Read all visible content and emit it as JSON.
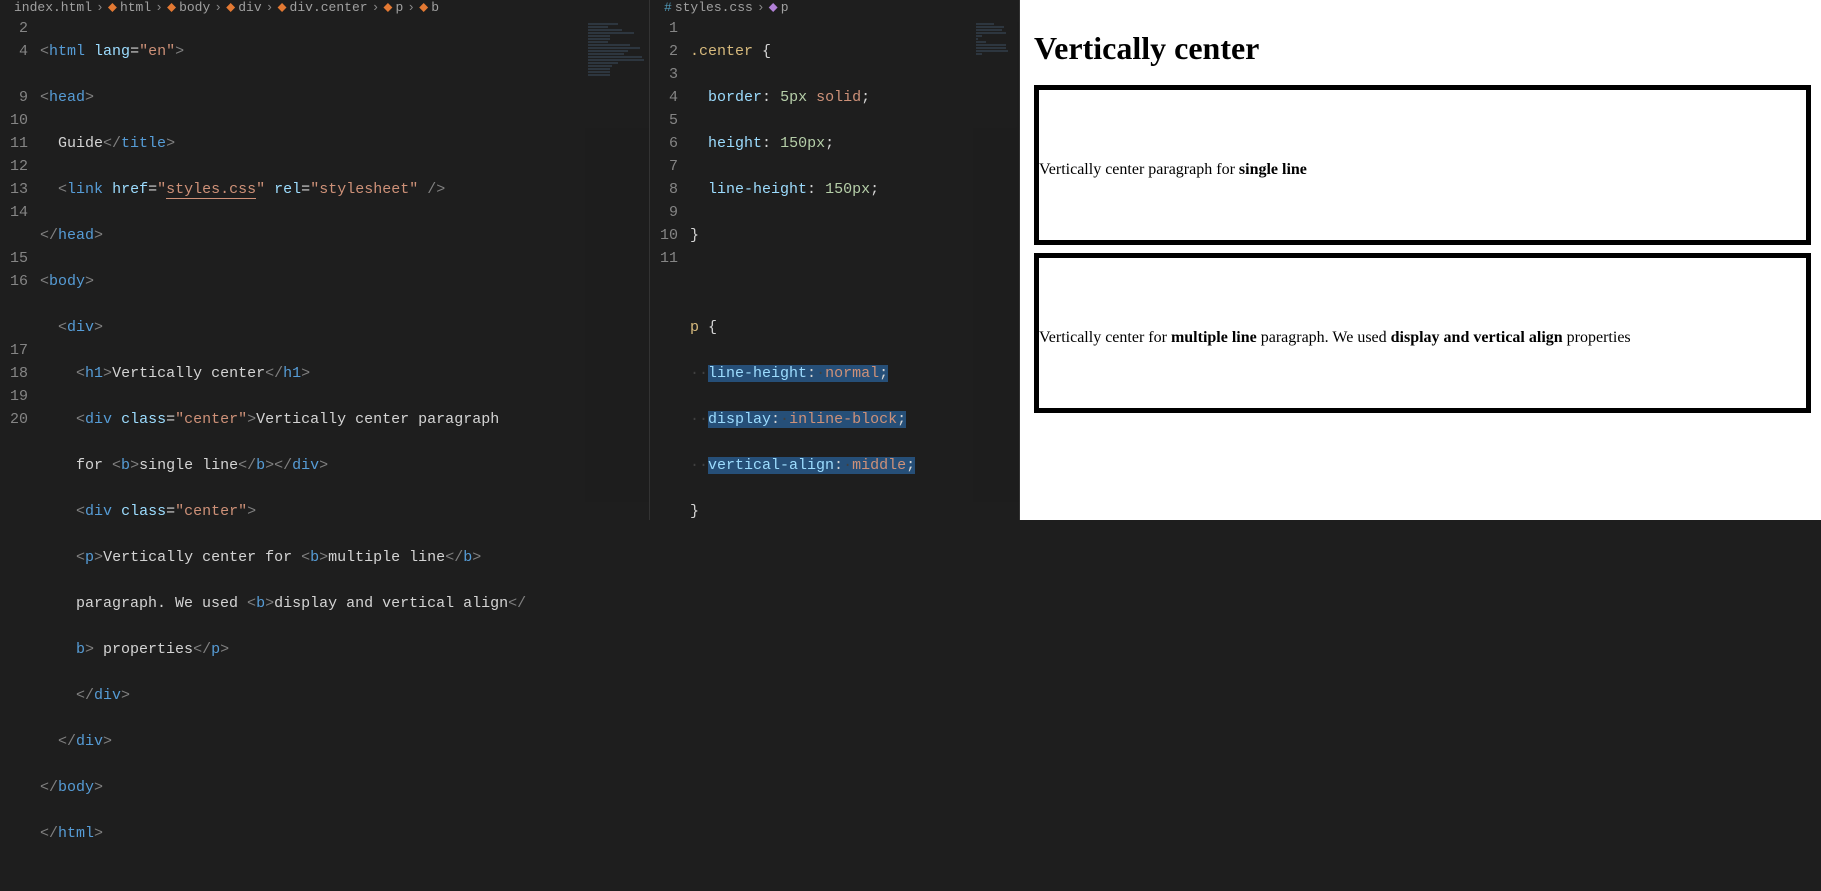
{
  "left": {
    "breadcrumb": [
      "index.html",
      "html",
      "body",
      "div",
      "div.center",
      "p",
      "b"
    ],
    "lines": [
      {
        "n": "2"
      },
      {
        "n": "4"
      },
      {
        "n": ""
      },
      {
        "n": "9"
      },
      {
        "n": "10"
      },
      {
        "n": "11"
      },
      {
        "n": "12"
      },
      {
        "n": "13"
      },
      {
        "n": "14"
      },
      {
        "n": ""
      },
      {
        "n": "15"
      },
      {
        "n": "16"
      },
      {
        "n": ""
      },
      {
        "n": ""
      },
      {
        "n": "17"
      },
      {
        "n": "18"
      },
      {
        "n": "19"
      },
      {
        "n": "20"
      }
    ],
    "code": {
      "l2_lang": "en",
      "l3_guide": "Guide",
      "l9_href": "styles.css",
      "l9_rel": "stylesheet",
      "l13_h1": "Vertically center",
      "l14_class": "center",
      "l14_text1": "Vertically center paragraph",
      "l14b_text2": "for ",
      "l14b_bold": "single line",
      "l15_class": "center",
      "l16_text1": "Vertically center for ",
      "l16_bold1": "multiple line",
      "l16c_text2": "paragraph. We used ",
      "l16c_bold2": "display and vertical align",
      "l16d_text3": " properties"
    }
  },
  "right": {
    "breadcrumb": [
      "styles.css",
      "p"
    ],
    "lines": [
      "1",
      "2",
      "3",
      "4",
      "5",
      "6",
      "7",
      "8",
      "9",
      "10",
      "11"
    ],
    "css": {
      "sel1": ".center",
      "p1": "border",
      "v1a": "5px",
      "v1b": "solid",
      "p2": "height",
      "v2": "150px",
      "p3": "line-height",
      "v3": "150px",
      "sel2": "p",
      "p4": "line-height",
      "v4": "normal",
      "p5": "display",
      "v5": "inline-block",
      "p6": "vertical-align",
      "v6": "middle"
    }
  },
  "preview": {
    "h1": "Vertically center",
    "box1_text": "Vertically center paragraph for ",
    "box1_bold": "single line",
    "box2_text1": "Vertically center for ",
    "box2_bold1": "multiple line",
    "box2_text2": " paragraph. We used ",
    "box2_bold2": "display and vertical align",
    "box2_text3": " properties"
  }
}
